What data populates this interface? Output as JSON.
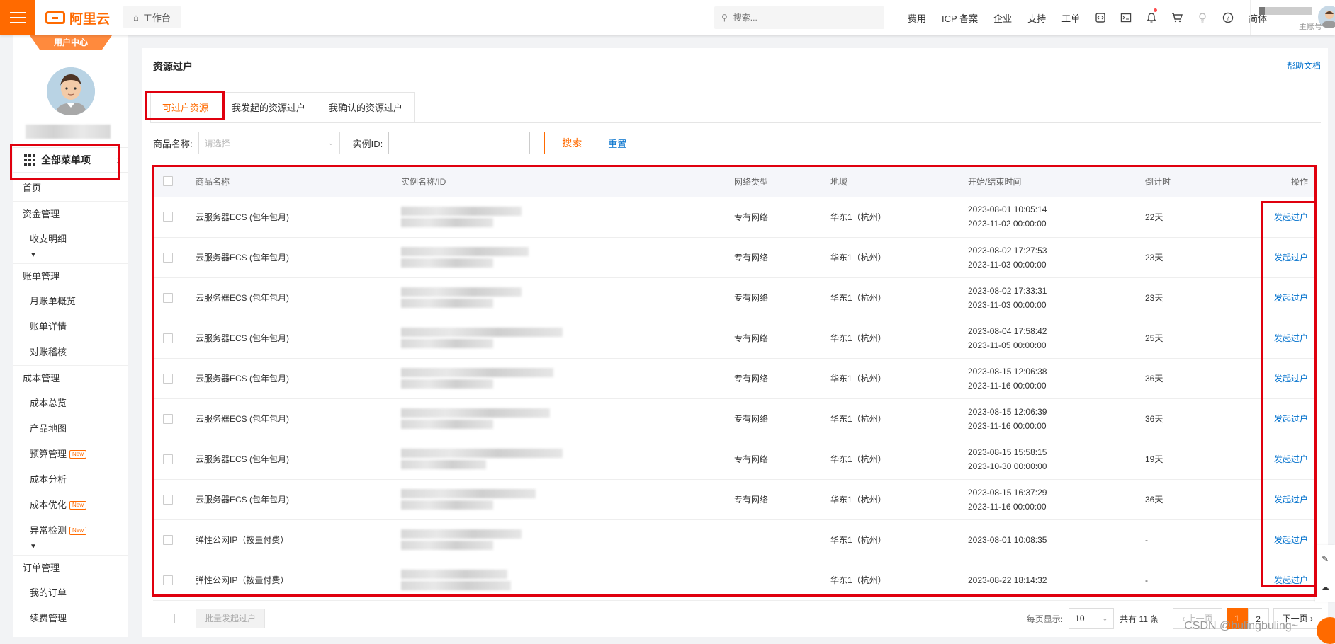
{
  "header": {
    "brand": "阿里云",
    "workbench": "工作台",
    "search_placeholder": "搜索...",
    "nav": [
      "费用",
      "ICP 备案",
      "企业",
      "支持",
      "工单"
    ],
    "lang": "简体",
    "account_sub": "主账号"
  },
  "sidebar": {
    "user_center": "用户中心",
    "all_menu": "全部菜单项",
    "items": [
      {
        "label": "首页",
        "type": "top"
      },
      {
        "label": "资金管理",
        "type": "section"
      },
      {
        "label": "收支明细",
        "type": "sub"
      },
      {
        "label": "账单管理",
        "type": "section"
      },
      {
        "label": "月账单概览",
        "type": "sub"
      },
      {
        "label": "账单详情",
        "type": "sub"
      },
      {
        "label": "对账稽核",
        "type": "sub"
      },
      {
        "label": "成本管理",
        "type": "section"
      },
      {
        "label": "成本总览",
        "type": "sub"
      },
      {
        "label": "产品地图",
        "type": "sub"
      },
      {
        "label": "预算管理",
        "type": "sub",
        "badge": "New"
      },
      {
        "label": "成本分析",
        "type": "sub"
      },
      {
        "label": "成本优化",
        "type": "sub",
        "badge": "New"
      },
      {
        "label": "异常检测",
        "type": "sub",
        "badge": "New"
      },
      {
        "label": "订单管理",
        "type": "section"
      },
      {
        "label": "我的订单",
        "type": "sub"
      },
      {
        "label": "续费管理",
        "type": "sub"
      }
    ]
  },
  "main": {
    "title": "资源过户",
    "help": "帮助文档",
    "tabs": [
      "可过户资源",
      "我发起的资源过户",
      "我确认的资源过户"
    ],
    "filter": {
      "product_label": "商品名称:",
      "product_placeholder": "请选择",
      "instance_label": "实例ID:",
      "search_btn": "搜索",
      "reset": "重置"
    },
    "table": {
      "columns": [
        "商品名称",
        "实例名称/ID",
        "网络类型",
        "地域",
        "开始/结束时间",
        "倒计时",
        "操作"
      ],
      "rows": [
        {
          "product": "云服务器ECS (包年包月)",
          "network": "专有网络",
          "region": "华东1（杭州）",
          "start": "2023-08-01 10:05:14",
          "end": "2023-11-02 00:00:00",
          "countdown": "22天",
          "action": "发起过户"
        },
        {
          "product": "云服务器ECS (包年包月)",
          "network": "专有网络",
          "region": "华东1（杭州）",
          "start": "2023-08-02 17:27:53",
          "end": "2023-11-03 00:00:00",
          "countdown": "23天",
          "action": "发起过户"
        },
        {
          "product": "云服务器ECS (包年包月)",
          "network": "专有网络",
          "region": "华东1（杭州）",
          "start": "2023-08-02 17:33:31",
          "end": "2023-11-03 00:00:00",
          "countdown": "23天",
          "action": "发起过户"
        },
        {
          "product": "云服务器ECS (包年包月)",
          "network": "专有网络",
          "region": "华东1（杭州）",
          "start": "2023-08-04 17:58:42",
          "end": "2023-11-05 00:00:00",
          "countdown": "25天",
          "action": "发起过户"
        },
        {
          "product": "云服务器ECS (包年包月)",
          "network": "专有网络",
          "region": "华东1（杭州）",
          "start": "2023-08-15 12:06:38",
          "end": "2023-11-16 00:00:00",
          "countdown": "36天",
          "action": "发起过户"
        },
        {
          "product": "云服务器ECS (包年包月)",
          "network": "专有网络",
          "region": "华东1（杭州）",
          "start": "2023-08-15 12:06:39",
          "end": "2023-11-16 00:00:00",
          "countdown": "36天",
          "action": "发起过户"
        },
        {
          "product": "云服务器ECS (包年包月)",
          "network": "专有网络",
          "region": "华东1（杭州）",
          "start": "2023-08-15 15:58:15",
          "end": "2023-10-30 00:00:00",
          "countdown": "19天",
          "action": "发起过户"
        },
        {
          "product": "云服务器ECS (包年包月)",
          "network": "专有网络",
          "region": "华东1（杭州）",
          "start": "2023-08-15 16:37:29",
          "end": "2023-11-16 00:00:00",
          "countdown": "36天",
          "action": "发起过户"
        },
        {
          "product": "弹性公网IP（按量付费）",
          "network": "",
          "region": "华东1（杭州）",
          "start": "2023-08-01 10:08:35",
          "end": "",
          "countdown": "-",
          "action": "发起过户"
        },
        {
          "product": "弹性公网IP（按量付费）",
          "network": "",
          "region": "华东1（杭州）",
          "start": "2023-08-22 18:14:32",
          "end": "",
          "countdown": "-",
          "action": "发起过户"
        }
      ]
    },
    "bottom": {
      "batch": "批量发起过户",
      "per_page_label": "每页显示:",
      "per_page": "10",
      "total": "共有 11 条",
      "prev": "上一页",
      "next": "下一页",
      "pages": [
        "1",
        "2"
      ]
    }
  },
  "watermark": "CSDN @bulingbuling~",
  "colors": {
    "brand": "#ff6a00",
    "link": "#0070cc",
    "annotation": "#e0000e"
  }
}
